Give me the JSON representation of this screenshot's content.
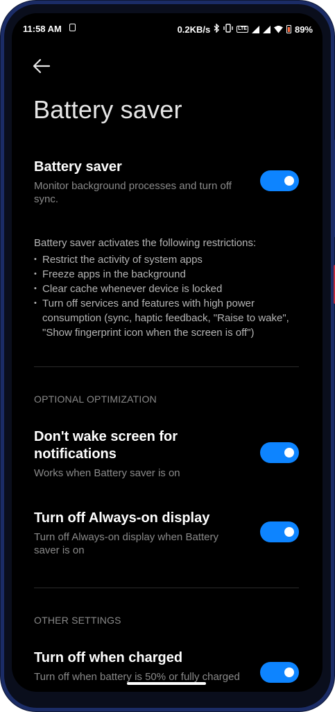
{
  "status_bar": {
    "time": "11:58 AM",
    "net_speed": "0.2KB/s",
    "battery_level": "89%",
    "icons": [
      "lock-icon",
      "bluetooth-icon",
      "vibrate-icon",
      "lte-icon",
      "signal-icon",
      "signal-icon",
      "wifi-icon",
      "battery-icon"
    ],
    "lte_label": "LTE"
  },
  "header": {
    "back_icon": "arrow-left-icon",
    "title": "Battery saver"
  },
  "battery_saver": {
    "title": "Battery saver",
    "description": "Monitor background processes and turn off sync.",
    "enabled": true
  },
  "restrictions": {
    "intro": "Battery saver activates the following restrictions:",
    "items": [
      "Restrict the activity of system apps",
      "Freeze apps in the background",
      "Clear cache whenever device is locked",
      "Turn off services and features with high power consumption (sync, haptic feedback, \"Raise to wake\", \"Show fingerprint icon when the screen is off\")"
    ]
  },
  "optional_section": {
    "label": "OPTIONAL OPTIMIZATION",
    "items": [
      {
        "title": "Don't wake screen for notifications",
        "description": "Works when Battery saver is on",
        "enabled": true
      },
      {
        "title": "Turn off Always-on display",
        "description": "Turn off Always-on display when Battery saver is on",
        "enabled": true
      }
    ]
  },
  "other_section": {
    "label": "OTHER SETTINGS",
    "items": [
      {
        "title": "Turn off when charged",
        "description": "Turn off when battery is 50% or fully charged",
        "enabled": true
      }
    ]
  },
  "colors": {
    "accent": "#0d84ff",
    "background": "#000000",
    "frame": "#1b2c66"
  }
}
